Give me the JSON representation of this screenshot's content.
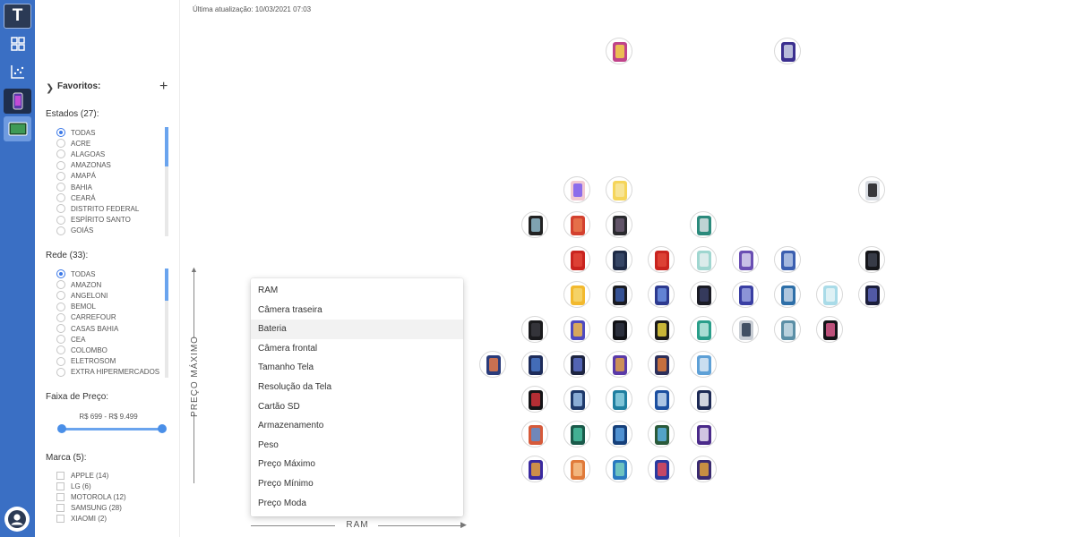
{
  "app": {
    "logo_letter": "T",
    "last_update": "Última atualização: 10/03/2021 07:03"
  },
  "rail": {
    "icons": [
      "grid-icon",
      "scatter-chart-icon",
      "smartphone-icon",
      "tablet-icon",
      "user-icon"
    ],
    "accent": "#3a6fc4"
  },
  "favorites": {
    "label": "Favoritos:",
    "add": "+"
  },
  "states": {
    "title": "Estados (27):",
    "options": [
      "TODAS",
      "ACRE",
      "ALAGOAS",
      "AMAZONAS",
      "AMAPÁ",
      "BAHIA",
      "CEARÁ",
      "DISTRITO FEDERAL",
      "ESPÍRITO SANTO",
      "GOIÁS"
    ],
    "selected": "TODAS"
  },
  "network": {
    "title": "Rede (33):",
    "options": [
      "TODAS",
      "AMAZON",
      "ANGELONI",
      "BEMOL",
      "CARREFOUR",
      "CASAS BAHIA",
      "CEA",
      "COLOMBO",
      "ELETROSOM",
      "EXTRA HIPERMERCADOS"
    ],
    "selected": "TODAS"
  },
  "price": {
    "title": "Faixa de Preço:",
    "range": "R$ 699 - R$ 9.499"
  },
  "brand": {
    "title": "Marca (5):",
    "options": [
      "APPLE (14)",
      "LG (6)",
      "MOTOROLA (12)",
      "SAMSUNG (28)",
      "XIAOMI (2)"
    ]
  },
  "axes": {
    "y_label": "PREÇO MÁXIMO",
    "x_label": "RAM"
  },
  "dropdown": {
    "options": [
      "RAM",
      "Câmera traseira",
      "Bateria",
      "Câmera frontal",
      "Tamanho Tela",
      "Resolução da Tela",
      "Cartão SD",
      "Armazenamento",
      "Peso",
      "Preço Máximo",
      "Preço Mínimo",
      "Preço Moda"
    ],
    "highlighted": "Bateria"
  },
  "colors": {
    "accent": "#3b78e7",
    "slider": "#6aa4ee"
  }
}
